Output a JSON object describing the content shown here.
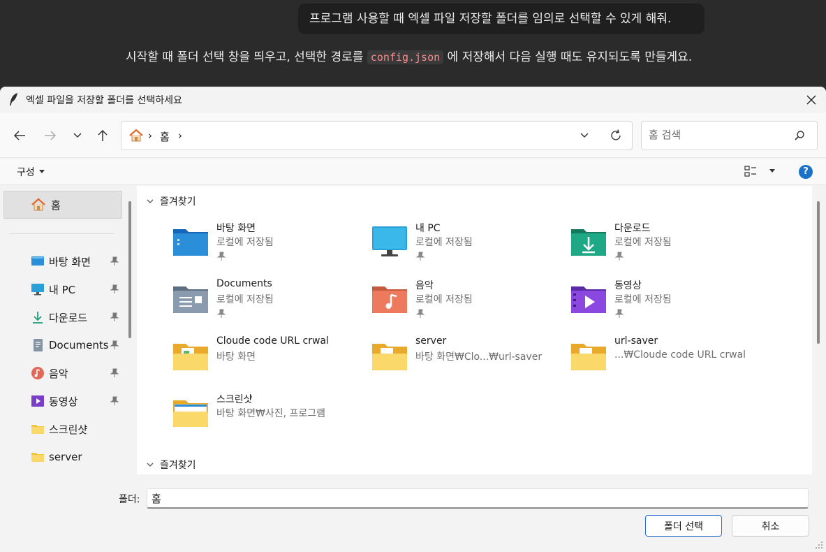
{
  "chat": {
    "user_message": "프로그램 사용할 때 엑셀 파일 저장할 폴더를 임의로 선택할 수 있게 해줘.",
    "reply_before": "시작할 때 폴더 선택 창을 띄우고, 선택한 경로를 ",
    "reply_code": "config.json",
    "reply_after": " 에 저장해서 다음 실행 때도 유지되도록 만들게요."
  },
  "dialog": {
    "title": "엑셀 파일을 저장할 폴더를 선택하세요",
    "breadcrumb": [
      "홈"
    ],
    "search_placeholder": "홈 검색",
    "organize_label": "구성",
    "help_label": "?",
    "sidebar": {
      "home_label": "홈",
      "items": [
        {
          "label": "바탕 화면",
          "icon": "desktop-icon",
          "pinned": true
        },
        {
          "label": "내 PC",
          "icon": "pc-icon",
          "pinned": true
        },
        {
          "label": "다운로드",
          "icon": "download-icon",
          "pinned": true
        },
        {
          "label": "Documents",
          "icon": "document-icon",
          "pinned": true
        },
        {
          "label": "음악",
          "icon": "music-icon",
          "pinned": true
        },
        {
          "label": "동영상",
          "icon": "video-icon",
          "pinned": true
        },
        {
          "label": "스크린샷",
          "icon": "folder-icon",
          "pinned": false
        },
        {
          "label": "server",
          "icon": "folder-icon",
          "pinned": false
        }
      ]
    },
    "groups": [
      {
        "label": "즐겨찾기"
      },
      {
        "label": "즐겨찾기"
      }
    ],
    "tiles": [
      {
        "name": "바탕 화면",
        "sub": "로컬에 저장됨",
        "icon": "desktop-folder-icon",
        "pinned": true
      },
      {
        "name": "내 PC",
        "sub": "로컬에 저장됨",
        "icon": "monitor-icon",
        "pinned": true
      },
      {
        "name": "다운로드",
        "sub": "로컬에 저장됨",
        "icon": "download-folder-icon",
        "pinned": true
      },
      {
        "name": "Documents",
        "sub": "로컬에 저장됨",
        "icon": "documents-folder-icon",
        "pinned": true
      },
      {
        "name": "음악",
        "sub": "로컬에 저장됨",
        "icon": "music-folder-icon",
        "pinned": true
      },
      {
        "name": "동영상",
        "sub": "로컬에 저장됨",
        "icon": "video-folder-icon",
        "pinned": true
      },
      {
        "name": "Cloude code URL crwal",
        "sub": "바탕 화면",
        "icon": "folder-icon",
        "pinned": false
      },
      {
        "name": "server",
        "sub": "바탕 화면₩Clo...₩url-saver",
        "icon": "folder-icon",
        "pinned": false
      },
      {
        "name": "url-saver",
        "sub": "...₩Cloude code URL crwal",
        "icon": "folder-icon",
        "pinned": false
      },
      {
        "name": "스크린샷",
        "sub": "바탕 화면₩사진, 프로그램",
        "icon": "folder-icon",
        "pinned": false
      }
    ],
    "folder_label": "폴더:",
    "folder_value": "홈",
    "select_button": "폴더 선택",
    "cancel_button": "취소"
  },
  "colors": {
    "accent": "#2a73c8",
    "folder_yellow": "#f5c542",
    "chat_bg": "#2b2b2b"
  }
}
